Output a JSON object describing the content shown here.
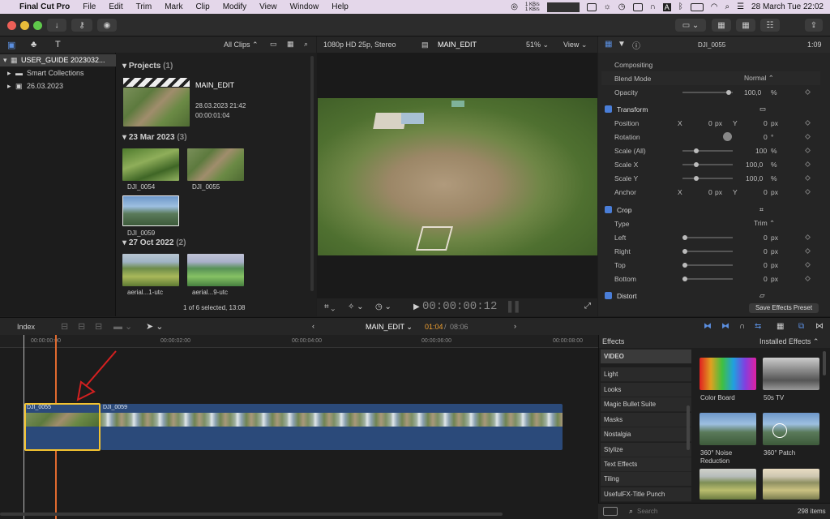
{
  "menubar": {
    "app": "Final Cut Pro",
    "items": [
      "File",
      "Edit",
      "Trim",
      "Mark",
      "Clip",
      "Modify",
      "View",
      "Window",
      "Help"
    ],
    "net_up": "1 KB/s",
    "net_down": "1 KB/s",
    "clock": "28 March Tue  22:02"
  },
  "browser": {
    "filter": "All Clips",
    "library": "USER_GUIDE 2023032...",
    "smart_collections": "Smart Collections",
    "event": "26.03.2023",
    "projects_label": "Projects",
    "projects_count": "(1)",
    "project_name": "MAIN_EDIT",
    "project_date": "28.03.2023 21:42",
    "project_duration": "00:00:01:04",
    "group1_label": "23 Mar 2023",
    "group1_count": "(3)",
    "clip1": "DJI_0054",
    "clip2": "DJI_0055",
    "clip3": "DJI_0059",
    "group2_label": "27 Oct 2022",
    "group2_count": "(2)",
    "clip4": "aerial...1-utc",
    "clip5": "aerial...9-utc",
    "status": "1 of 6 selected, 13:08"
  },
  "viewer": {
    "format": "1080p HD 25p, Stereo",
    "title": "MAIN_EDIT",
    "zoom": "51%",
    "view": "View",
    "timecode": "00:00:00:12"
  },
  "inspector": {
    "clip_name": "DJI_0055",
    "duration": "1:09",
    "compositing": "Compositing",
    "blend_mode_label": "Blend Mode",
    "blend_mode_value": "Normal",
    "opacity_label": "Opacity",
    "opacity_value": "100,0",
    "transform": "Transform",
    "position_label": "Position",
    "position_x": "0",
    "position_y": "0",
    "rotation_label": "Rotation",
    "rotation_value": "0",
    "scale_all_label": "Scale (All)",
    "scale_all_value": "100",
    "scale_x_label": "Scale X",
    "scale_x_value": "100,0",
    "scale_y_label": "Scale Y",
    "scale_y_value": "100,0",
    "anchor_label": "Anchor",
    "anchor_x": "0",
    "anchor_y": "0",
    "crop": "Crop",
    "type_label": "Type",
    "type_value": "Trim",
    "left_label": "Left",
    "right_label": "Right",
    "top_label": "Top",
    "bottom_label": "Bottom",
    "crop_value": "0",
    "distort": "Distort",
    "save_preset": "Save Effects Preset",
    "unit_px": "px",
    "unit_pct": "%",
    "unit_deg": "°",
    "x": "X",
    "y": "Y"
  },
  "timeline": {
    "index": "Index",
    "project": "MAIN_EDIT",
    "position": "01:04",
    "total": "08:06",
    "ruler": [
      "00:00:00:00",
      "00:00:02:00",
      "00:00:04:00",
      "00:00:06:00",
      "00:00:08:00"
    ],
    "clip_a": "DJI_0055",
    "clip_b": "DJI_0059"
  },
  "effects": {
    "title": "Effects",
    "installed": "Installed Effects",
    "categories": [
      "VIDEO",
      "Light",
      "Looks",
      "Magic Bullet Suite",
      "Masks",
      "Nostalgia",
      "Stylize",
      "Text Effects",
      "Tiling",
      "UsefulFX-Title Punch"
    ],
    "items": [
      "Color Board",
      "50s TV",
      "360° Noise Reduction",
      "360° Patch"
    ],
    "search_placeholder": "Search",
    "count": "298 items"
  },
  "colors": {
    "accent": "#4a7ed8",
    "selection": "#f2c230",
    "playhead": "#e06a2f",
    "clip_blue": "#2b4a7a",
    "timecode_orange": "#f0a030"
  }
}
